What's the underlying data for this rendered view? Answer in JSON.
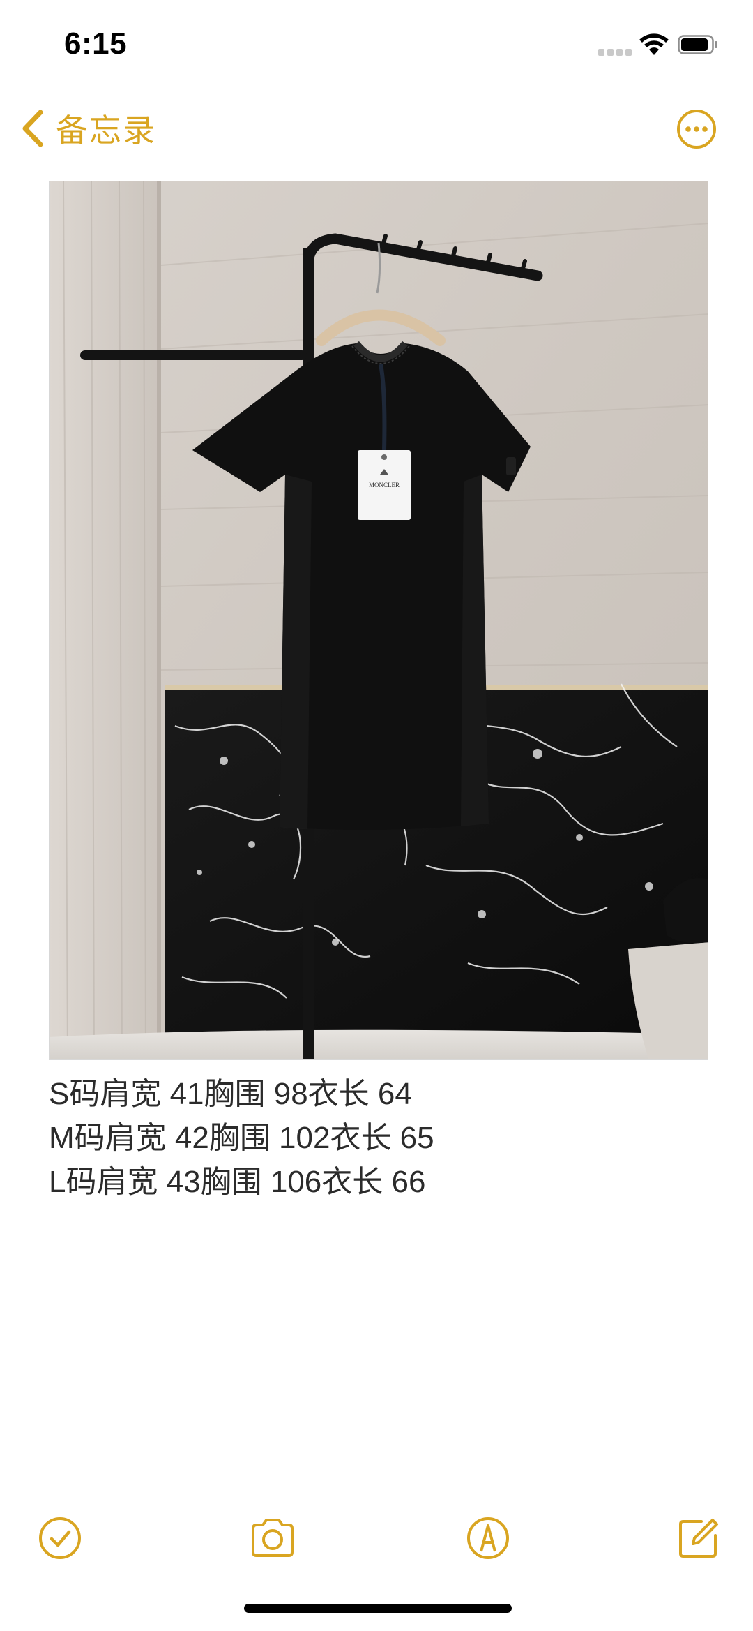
{
  "status_bar": {
    "time": "6:15",
    "signal_icon": "cellular-signal-icon",
    "wifi_icon": "wifi-icon",
    "battery_icon": "battery-icon"
  },
  "nav": {
    "back_label": "备忘录",
    "back_icon": "chevron-left-icon",
    "more_icon": "ellipsis-circle-icon"
  },
  "photo": {
    "description_icon": "tshirt-photo",
    "tag_brand": "MONCLER"
  },
  "note": {
    "lines": [
      "S码肩宽 41胸围 98衣长 64",
      "M码肩宽 42胸围 102衣长 65",
      "L码肩宽 43胸围 106衣长 66"
    ]
  },
  "toolbar": {
    "checklist_icon": "checklist-icon",
    "camera_icon": "camera-icon",
    "markup_icon": "markup-pen-icon",
    "compose_icon": "compose-icon"
  },
  "colors": {
    "accent": "#d9a521",
    "text": "#2b2b2b"
  }
}
